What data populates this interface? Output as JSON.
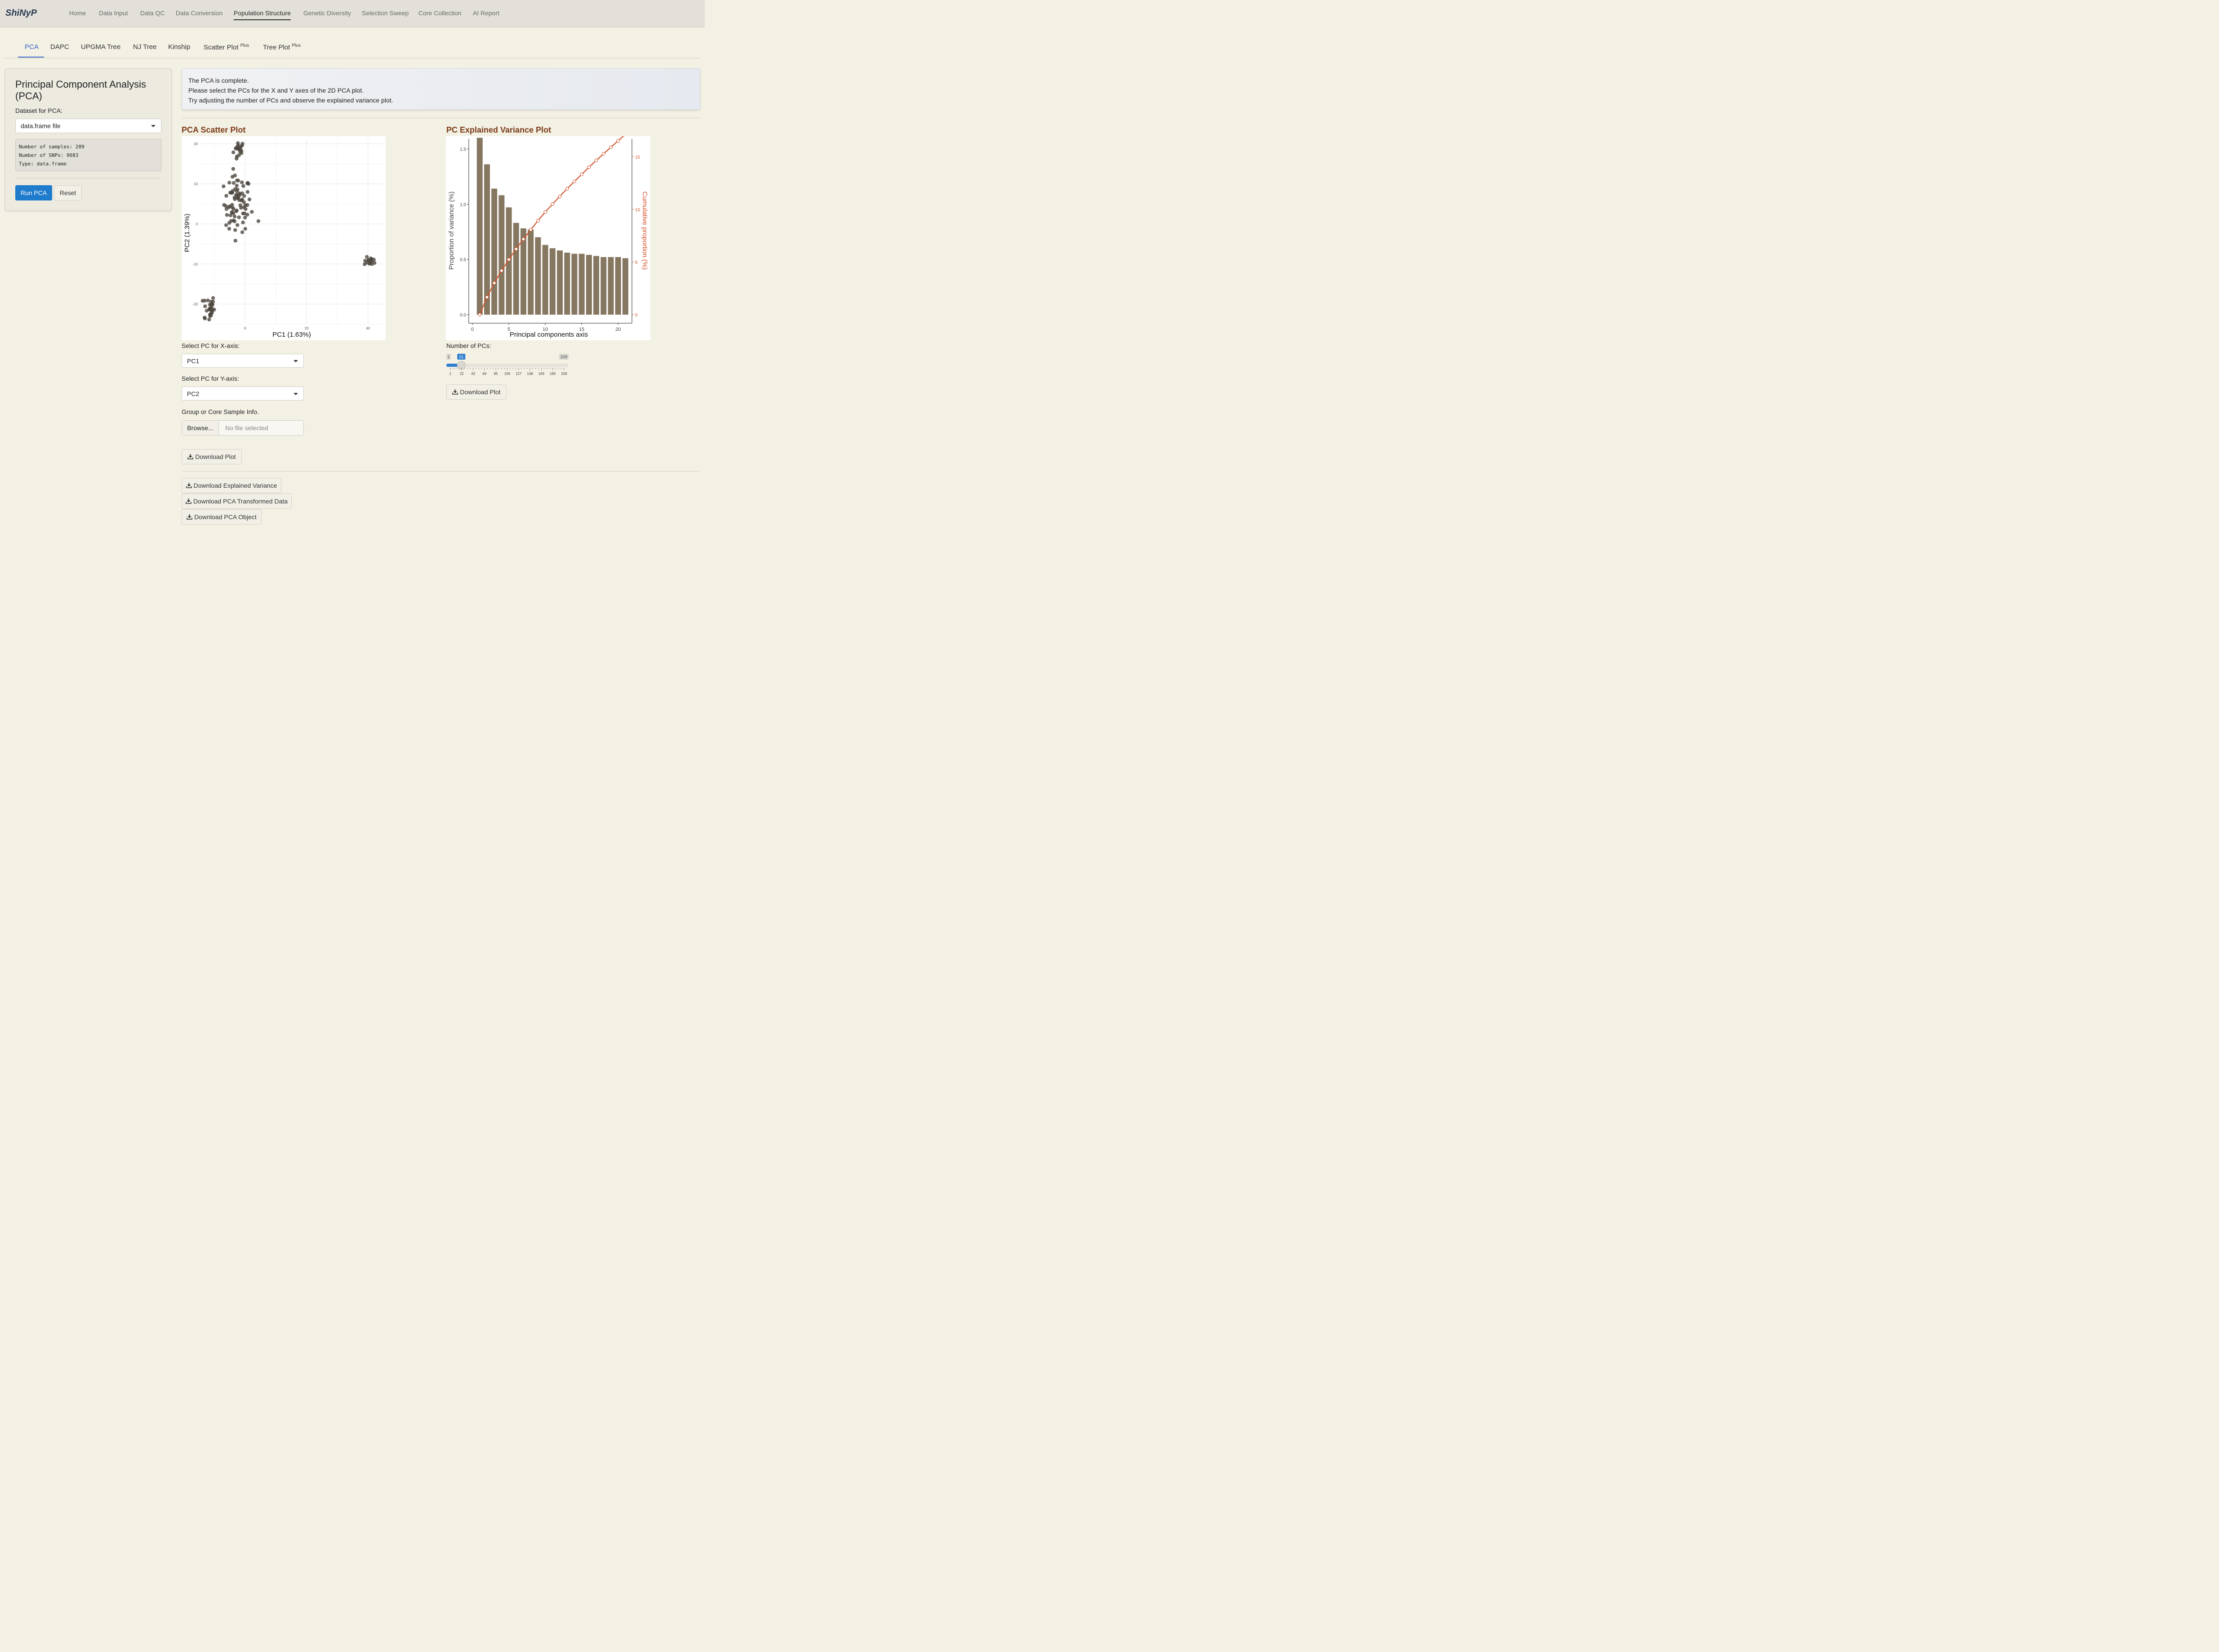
{
  "app": {
    "brand": "ShiNyP"
  },
  "nav": {
    "items": [
      "Home",
      "Data Input",
      "Data QC",
      "Data Conversion",
      "Population Structure",
      "Genetic Diversity",
      "Selection Sweep",
      "Core Collection",
      "AI Report"
    ],
    "active": "Population Structure"
  },
  "subtabs": {
    "items": [
      {
        "label": "PCA",
        "sup": ""
      },
      {
        "label": "DAPC",
        "sup": ""
      },
      {
        "label": "UPGMA Tree",
        "sup": ""
      },
      {
        "label": "NJ Tree",
        "sup": ""
      },
      {
        "label": "Kinship",
        "sup": ""
      },
      {
        "label": "Scatter Plot",
        "sup": "Plus"
      },
      {
        "label": "Tree Plot",
        "sup": "Plus"
      }
    ],
    "active": "PCA"
  },
  "sidebar": {
    "title": "Principal Component Analysis (PCA)",
    "dataset_label": "Dataset for PCA:",
    "dataset_value": "data.frame file",
    "info_lines": [
      "Number of samples: 209",
      "Number of SNPs: 9683",
      "Type: data.frame"
    ],
    "run_label": "Run PCA",
    "reset_label": "Reset"
  },
  "alert": {
    "lines": [
      "The PCA is complete.",
      "Please select the PCs for the X and Y axes of the 2D PCA plot.",
      "Try adjusting the number of PCs and observe the explained variance plot."
    ]
  },
  "scatter_section": {
    "title": "PCA Scatter Plot",
    "x_label": "Select PC for X-axis:",
    "x_value": "PC1",
    "y_label": "Select PC for Y-axis:",
    "y_value": "PC2",
    "group_label": "Group or Core Sample Info.",
    "browse_label": "Browse...",
    "file_placeholder": "No file selected",
    "download_label": "Download Plot"
  },
  "variance_section": {
    "title": "PC Explained Variance Plot",
    "npc_label": "Number of PCs:",
    "slider": {
      "min": 1,
      "max": 209,
      "value": 21,
      "ticks": [
        "1",
        "22",
        "43",
        "64",
        "85",
        "106",
        "127",
        "148",
        "169",
        "190",
        "209"
      ]
    },
    "download_label": "Download Plot"
  },
  "downloads": {
    "explained_variance": "Download Explained Variance",
    "transformed_data": "Download PCA Transformed Data",
    "pca_object": "Download PCA Object"
  },
  "colors": {
    "accent": "#1f7bcc",
    "title": "#7a3b17",
    "bar": "#857760",
    "line": "#d2522a",
    "point": "#4d473f"
  },
  "chart_data": [
    {
      "type": "scatter",
      "title": "",
      "xlabel": "PC1 (1.63%)",
      "ylabel": "PC2 (1.39%)",
      "xlim": [
        -15,
        45
      ],
      "ylim": [
        -25,
        21
      ],
      "xticks": [
        0,
        20,
        40
      ],
      "yticks": [
        -20,
        -10,
        0,
        10,
        20
      ],
      "grid": true,
      "clusters": [
        {
          "cx": -2,
          "cy": 18.5,
          "sx": 0.9,
          "sy": 1.2,
          "n": 18,
          "extra": [
            [
              -2.8,
              16.3
            ]
          ]
        },
        {
          "cx": -2.5,
          "cy": 5,
          "sx": 2.2,
          "sy": 3.5,
          "n": 78,
          "extra": [
            [
              4.3,
              0.7
            ],
            [
              -6.2,
              -0.3
            ],
            [
              -5.2,
              -1.2
            ]
          ]
        },
        {
          "cx": 40.8,
          "cy": -9.3,
          "sx": 1.0,
          "sy": 0.5,
          "n": 15,
          "extra": []
        },
        {
          "cx": -11.8,
          "cy": -21,
          "sx": 0.9,
          "sy": 1.7,
          "n": 28,
          "extra": [
            [
              -13.1,
              -23.6
            ]
          ]
        }
      ]
    },
    {
      "type": "bar",
      "title": "",
      "xlabel": "Principal components axis",
      "ylabel": "Proportion of variance (%)",
      "y2label": "Cumulative proportion (%)",
      "categories": [
        1,
        2,
        3,
        4,
        5,
        6,
        7,
        8,
        9,
        10,
        11,
        12,
        13,
        14,
        15,
        16,
        17,
        18,
        19,
        20,
        21
      ],
      "values": [
        1.63,
        1.39,
        1.17,
        1.11,
        1.0,
        0.86,
        0.81,
        0.8,
        0.73,
        0.66,
        0.63,
        0.61,
        0.59,
        0.58,
        0.58,
        0.57,
        0.56,
        0.55,
        0.55,
        0.55,
        0.54
      ],
      "cumulative": [
        0.0,
        1.66,
        3.01,
        4.18,
        5.24,
        6.24,
        7.18,
        8.07,
        8.93,
        9.75,
        10.51,
        11.24,
        11.97,
        12.66,
        13.33,
        14.01,
        14.66,
        15.29,
        15.9,
        16.52,
        17.13
      ],
      "ylim": [
        0,
        1.62
      ],
      "y2lim": [
        0,
        17.0
      ],
      "yticks": [
        0.0,
        0.5,
        1.0,
        1.5
      ],
      "y2ticks": [
        0,
        5,
        10,
        15
      ],
      "xticks": [
        0,
        5,
        10,
        15,
        20
      ]
    }
  ]
}
